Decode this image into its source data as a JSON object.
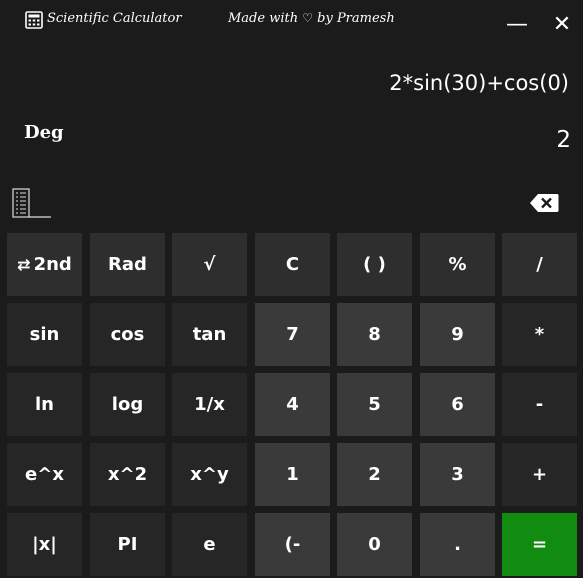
{
  "window": {
    "title": "Scientific Calculator",
    "credit_prefix": "Made with",
    "credit_heart": "♡",
    "credit_suffix": "by Pramesh",
    "minimize_label": "—",
    "close_label": "✕"
  },
  "display": {
    "expression": "2*sin(30)+cos(0)",
    "mode": "Deg",
    "result": "2"
  },
  "colors": {
    "background": "#1b1b1b",
    "key": "#2e2e2e",
    "key_number": "#3a3a3a",
    "equals": "#118c11"
  },
  "keys": {
    "row1": [
      "2nd",
      "Rad",
      "√",
      "C",
      "( )",
      "%",
      "/"
    ],
    "row2": [
      "sin",
      "cos",
      "tan",
      "7",
      "8",
      "9",
      "*"
    ],
    "row3": [
      "ln",
      "log",
      "1/x",
      "4",
      "5",
      "6",
      "-"
    ],
    "row4": [
      "e^x",
      "x^2",
      "x^y",
      "1",
      "2",
      "3",
      "+"
    ],
    "row5": [
      "|x|",
      "PI",
      "e",
      "(-",
      "0",
      ".",
      "="
    ]
  },
  "icons": {
    "app": "calculator-icon",
    "history": "history-icon",
    "backspace": "backspace-icon",
    "swap": "swap-arrows-icon"
  }
}
